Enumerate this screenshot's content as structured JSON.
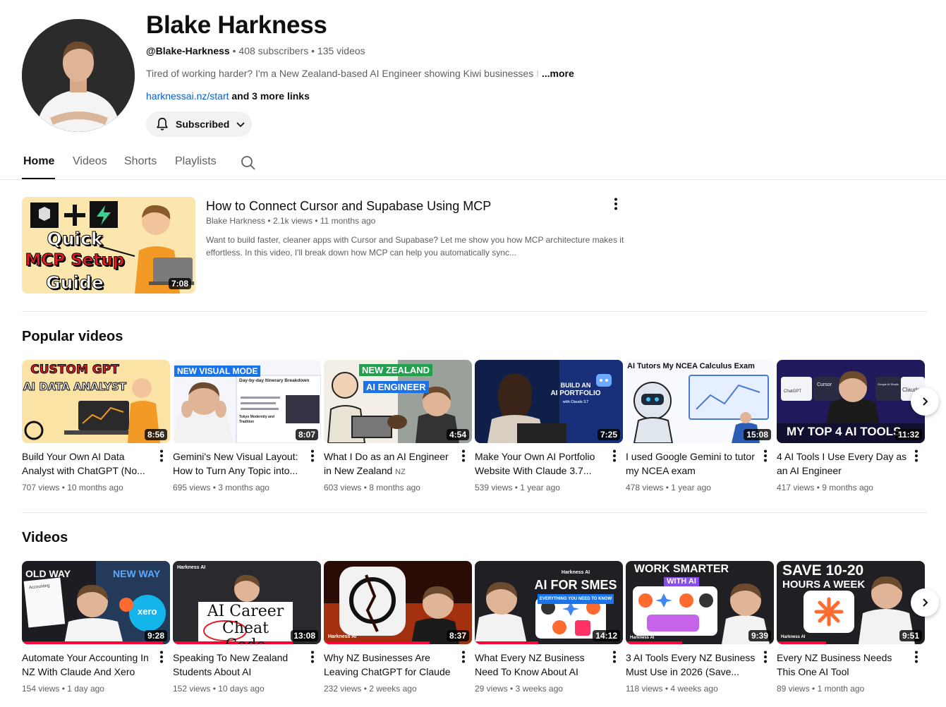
{
  "channel": {
    "name": "Blake Harkness",
    "handle": "@Blake-Harkness",
    "subscribers": "408 subscribers",
    "videos": "135 videos",
    "description": "Tired of working harder? I'm a New Zealand-based AI Engineer showing Kiwi businesses",
    "description_fade": " I",
    "more_label": "...more",
    "link": "harknessai.nz/start",
    "more_links": "and 3 more links",
    "subscribe_label": "Subscribed"
  },
  "tabs": [
    "Home",
    "Videos",
    "Shorts",
    "Playlists"
  ],
  "featured": {
    "title": "How to Connect Cursor and Supabase Using MCP",
    "author": "Blake Harkness",
    "views": "2.1k views",
    "age": "11 months ago",
    "description": "Want to build faster, cleaner apps with Cursor and Supabase? Let me show you how MCP architecture makes it effortless. In this video, I'll break down how MCP can help you automatically sync...",
    "duration": "7:08",
    "thumb_text": [
      "Quick",
      "MCP Setup",
      "Guide"
    ]
  },
  "popular": {
    "heading": "Popular videos",
    "items": [
      {
        "title": "Build Your Own AI Data Analyst with ChatGPT (No...",
        "views": "707 views",
        "age": "10 months ago",
        "duration": "8:56",
        "thumb_text": "CUSTOM GPT",
        "thumb_text2": "AI DATA ANALYST"
      },
      {
        "title": "Gemini's New Visual Layout: How to Turn Any Topic into...",
        "views": "695 views",
        "age": "3 months ago",
        "duration": "8:07",
        "thumb_text": "NEW VISUAL MODE",
        "thumb_text2": "Day-by-day Itinerary Breakdown",
        "thumb_text3": "Tokyo Modernity and Tradition"
      },
      {
        "title": "What I Do as an AI Engineer in New Zealand",
        "tag": "NZ",
        "views": "603 views",
        "age": "8 months ago",
        "duration": "4:54",
        "thumb_text": "NEW ZEALAND",
        "thumb_text2": "AI ENGINEER"
      },
      {
        "title": "Make Your Own AI Portfolio Website With Claude 3.7...",
        "views": "539 views",
        "age": "1 year ago",
        "duration": "7:25",
        "thumb_text": "BUILD AN",
        "thumb_text2": "AI PORTFOLIO",
        "thumb_text3": "with Claude 3.7"
      },
      {
        "title": "I used Google Gemini to tutor my NCEA exam",
        "views": "478 views",
        "age": "1 year ago",
        "duration": "15:08",
        "thumb_text": "AI Tutors My NCEA Calculus Exam"
      },
      {
        "title": "4 AI Tools I Use Every Day as an AI Engineer",
        "views": "417 views",
        "age": "9 months ago",
        "duration": "11:32",
        "thumb_text": "MY TOP 4 AI TOOLS",
        "thumb_text2": "ChatGPT",
        "thumb_text3": "Cursor",
        "thumb_text4": "Claude",
        "thumb_text5": "Google AI Studio"
      }
    ]
  },
  "videos": {
    "heading": "Videos",
    "items": [
      {
        "title": "Automate Your Accounting In NZ With Claude And Xero",
        "views": "154 views",
        "age": "1 day ago",
        "duration": "9:28",
        "thumb_text": "OLD WAY",
        "thumb_text2": "NEW WAY",
        "thumb_text3": "xero",
        "thumb_text4": "Accounting"
      },
      {
        "title": "Speaking To New Zealand Students About AI",
        "views": "152 views",
        "age": "10 days ago",
        "duration": "13:08",
        "thumb_text": "AI Career",
        "thumb_text2": "Cheat Code",
        "thumb_text3": "Harkness AI"
      },
      {
        "title": "Why NZ Businesses Are Leaving ChatGPT for Claude",
        "views": "232 views",
        "age": "2 weeks ago",
        "duration": "8:37",
        "thumb_text": "Harkness AI"
      },
      {
        "title": "What Every NZ Business Need To Know About AI",
        "views": "29 views",
        "age": "3 weeks ago",
        "duration": "14:12",
        "thumb_text": "AI FOR SMES",
        "thumb_text2": "EVERYTHING YOU NEED TO KNOW",
        "thumb_text3": "Harkness AI"
      },
      {
        "title": "3 AI Tools Every NZ Business Must Use in 2026 (Save...",
        "views": "118 views",
        "age": "4 weeks ago",
        "duration": "9:39",
        "thumb_text": "WORK SMARTER",
        "thumb_text2": "WITH AI",
        "thumb_text3": "Harkness AI"
      },
      {
        "title": "Every NZ Business Needs This One AI Tool",
        "views": "89 views",
        "age": "1 month ago",
        "duration": "9:51",
        "thumb_text": "SAVE 10-20",
        "thumb_text2": "HOURS A WEEK",
        "thumb_text3": "Harkness AI"
      }
    ]
  },
  "colors": {
    "link": "#065fd4",
    "progress": "#ff0033",
    "muted": "#606060"
  }
}
